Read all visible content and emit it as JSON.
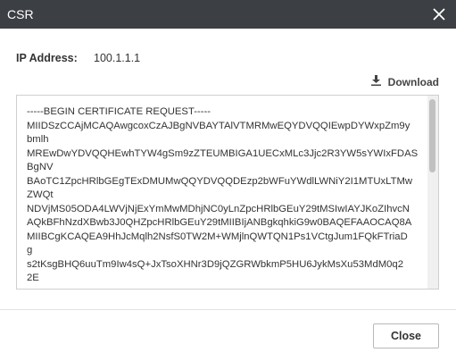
{
  "dialog": {
    "title": "CSR",
    "close_icon": "close-icon"
  },
  "ip": {
    "label": "IP Address:",
    "value": "100.1.1.1"
  },
  "download": {
    "icon": "download-icon",
    "label": "Download"
  },
  "csr": {
    "text": "-----BEGIN CERTIFICATE REQUEST-----\nMIIDSzCCAjMCAQAwgcoxCzAJBgNVBAYTAlVTMRMwEQYDVQQIEwpDYWxpZm9y\nbmlh\nMREwDwYDVQQHEwhTYW4gSm9zZTEUMBIGA1UECxMLc3Jjc2R3YW5sYWIxFDAS\nBgNV\nBAoTC1ZpcHRlbGEgTExDMUMwQQYDVQQDEzp2bWFuYWdlLWNiY2I1MTUxLTMw\nZWQt\nNDVjMS05ODA4LWVjNjExYmMwMDhjNC0yLnZpcHRlbGEuY29tMSIwIAYJKoZIhvcN\nAQkBFhNzdXBwb3J0QHZpcHRlbGEuY29tMIIBIjANBgkqhkiG9w0BAQEFAAOCAQ8A\nMIIBCgKCAQEA9HhJcMqlh2NsfS0TW2M+WMjlnQWTQN1Ps1VCtgJum1FQkFTriaD\ng\ns2tKsgBHQ6uuTm9Iw4sQ+JxTsoXHNr3D9jQZGRWbkmP5HU6JykMsXu53MdM0q2\n2E"
  },
  "footer": {
    "close_label": "Close"
  }
}
